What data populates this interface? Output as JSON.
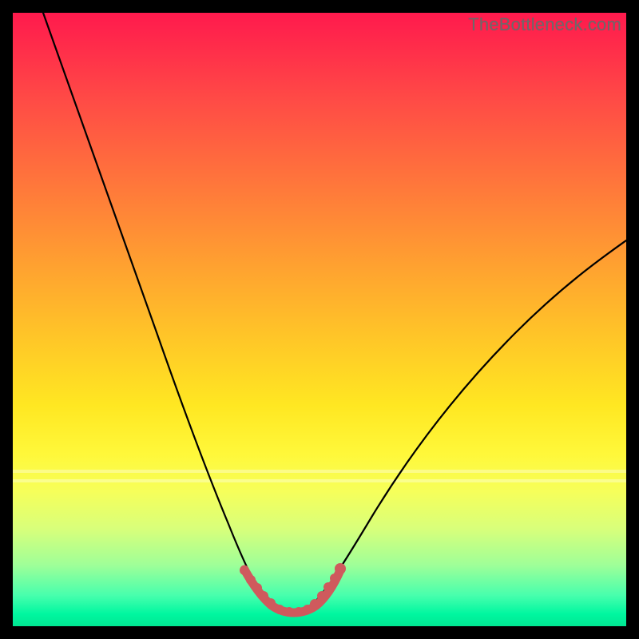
{
  "watermark": "TheBottleneck.com",
  "colors": {
    "background": "#000000",
    "curve": "#000000",
    "marker": "#cf5a5d",
    "gradient_top": "#ff1a4d",
    "gradient_bottom": "#00e792"
  },
  "chart_data": {
    "type": "line",
    "title": "",
    "xlabel": "",
    "ylabel": "",
    "xlim": [
      0,
      100
    ],
    "ylim": [
      0,
      100
    ],
    "annotations": [
      {
        "text": "TheBottleneck.com",
        "position": "top-right"
      }
    ],
    "series": [
      {
        "name": "left-curve",
        "x": [
          5,
          8,
          12,
          16,
          20,
          24,
          27,
          30,
          32,
          34,
          36,
          37.5,
          39,
          41,
          43,
          45
        ],
        "y": [
          100,
          89,
          76,
          63,
          51,
          40,
          32,
          25,
          20,
          16,
          12,
          9.5,
          7,
          4.5,
          2.8,
          2.3
        ]
      },
      {
        "name": "right-curve",
        "x": [
          45,
          47,
          49,
          51,
          53,
          55,
          58,
          62,
          66,
          72,
          80,
          90,
          100
        ],
        "y": [
          2.3,
          2.8,
          4.2,
          6.2,
          8.8,
          12,
          17,
          23,
          29,
          37,
          46,
          55,
          63
        ]
      },
      {
        "name": "optimal-markers",
        "x": [
          37.8,
          38.8,
          39.8,
          40.8,
          42.0,
          43.5,
          45.0,
          46.5,
          48.0,
          49.2,
          50.4,
          51.3,
          52.4,
          53.3
        ],
        "y": [
          9.0,
          7.6,
          6.4,
          5.3,
          4.2,
          3.2,
          2.6,
          2.6,
          3.2,
          4.4,
          5.8,
          7.2,
          8.5,
          10.0
        ]
      }
    ],
    "grid": false,
    "legend": false
  }
}
